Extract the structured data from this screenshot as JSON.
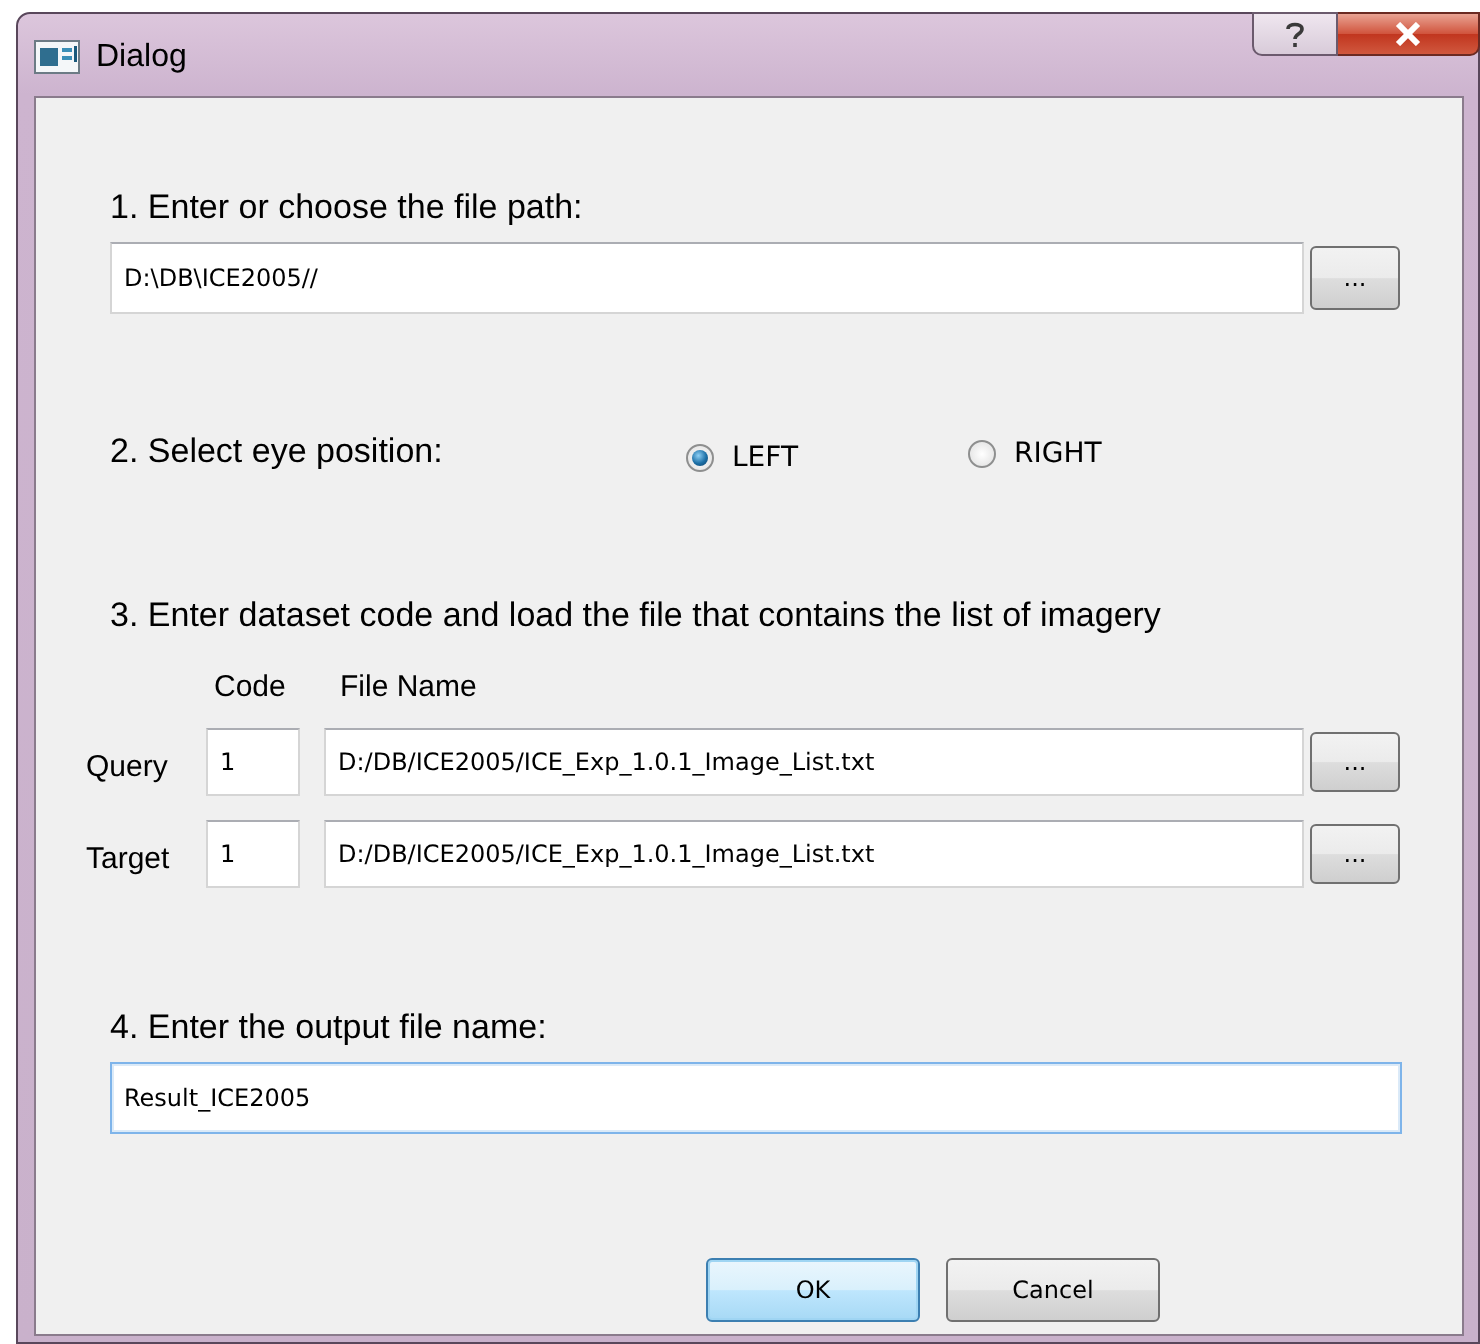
{
  "window": {
    "title": "Dialog"
  },
  "path_section": {
    "label": "1. Enter or choose the file path:",
    "value": "D:\\DB\\ICE2005//",
    "browse": "..."
  },
  "eye_section": {
    "label": "2. Select eye position:",
    "options": [
      {
        "label": "LEFT",
        "selected": true
      },
      {
        "label": "RIGHT",
        "selected": false
      }
    ]
  },
  "dataset_section": {
    "label": "3. Enter dataset code and load the file that contains the list of imagery",
    "columns": [
      "Code",
      "File Name"
    ],
    "rows": [
      {
        "label": "Query",
        "code": "1",
        "file": "D:/DB/ICE2005/ICE_Exp_1.0.1_Image_List.txt",
        "browse": "..."
      },
      {
        "label": "Target",
        "code": "1",
        "file": "D:/DB/ICE2005/ICE_Exp_1.0.1_Image_List.txt",
        "browse": "..."
      }
    ]
  },
  "output_section": {
    "label": "4. Enter the output file name:",
    "value": "Result_ICE2005",
    "focused": true
  },
  "buttons": [
    {
      "label": "OK",
      "default": true
    },
    {
      "label": "Cancel",
      "default": false
    }
  ]
}
